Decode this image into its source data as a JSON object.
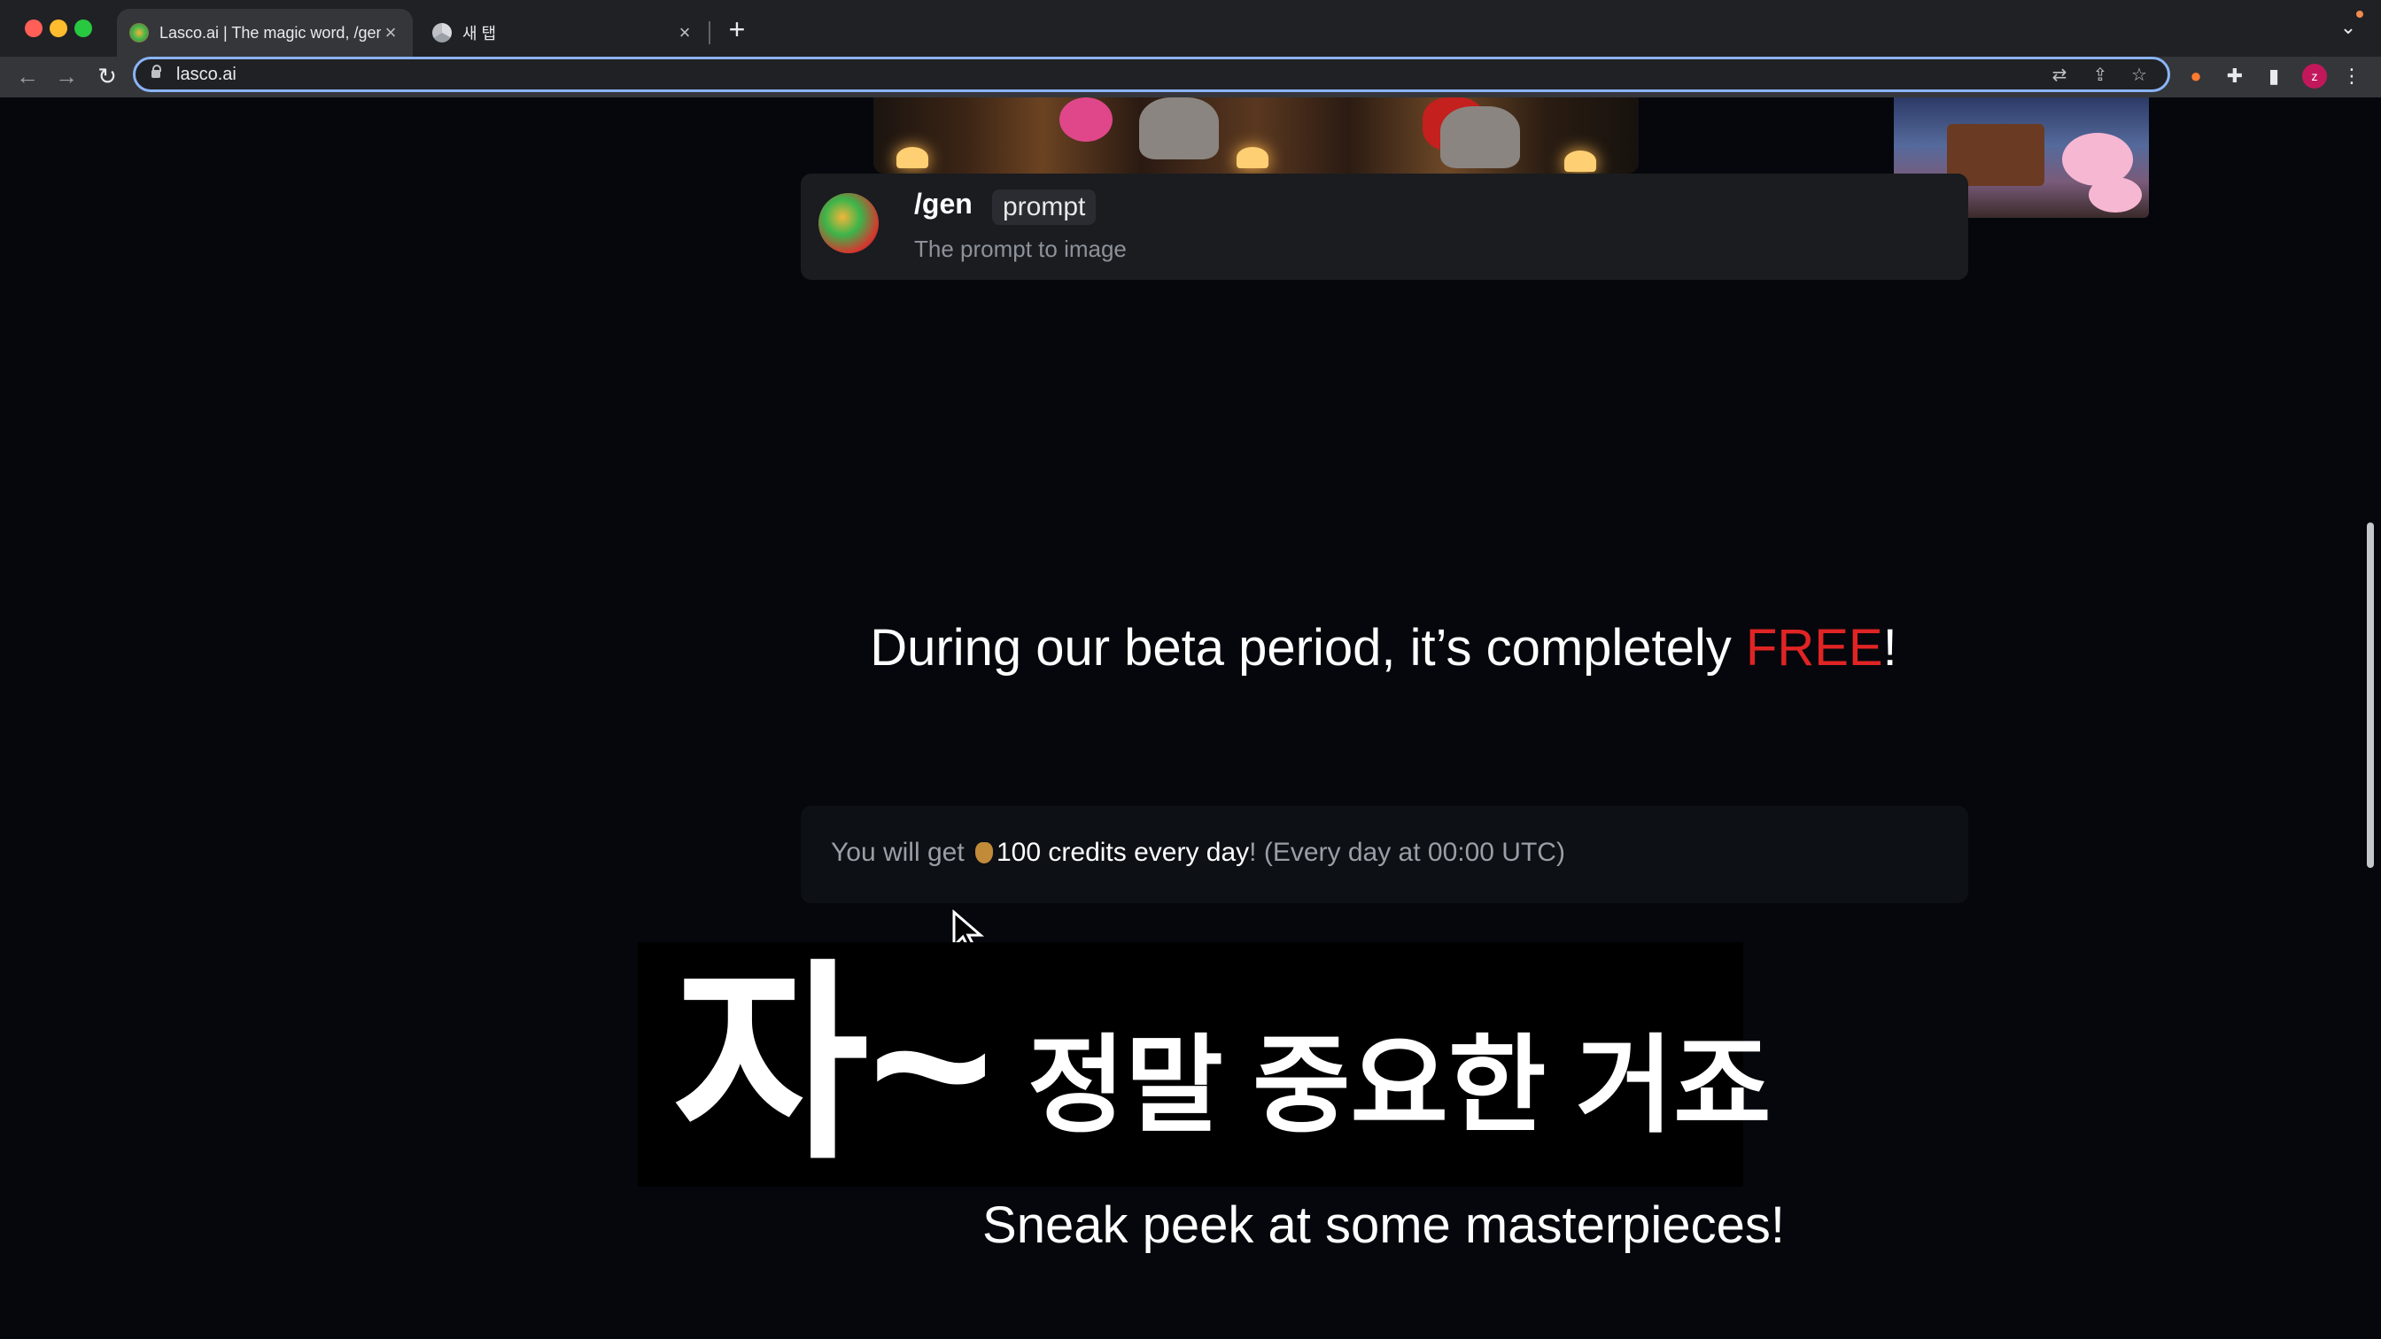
{
  "browser": {
    "tabs": [
      {
        "title": "Lasco.ai | The magic word, /gen",
        "active": true
      },
      {
        "title": "새 탭",
        "active": false
      }
    ],
    "new_tab_label": "+",
    "url": "lasco.ai",
    "profile_initial": "z"
  },
  "page": {
    "command_card": {
      "command": "/gen",
      "parameter": "prompt",
      "description": "The prompt to image"
    },
    "beta_banner": {
      "prefix": "During our beta period, it’s completely ",
      "highlight": "FREE",
      "suffix": "!"
    },
    "credits": {
      "prefix": "You will get ",
      "highlight": "100 credits every day",
      "suffix": "! (Every day at 00:00 UTC)"
    },
    "sneak_peek_title": "Sneak peek at some masterpieces!"
  },
  "caption": {
    "big": "자~",
    "small": "정말 중요한 거죠"
  },
  "colors": {
    "free_highlight": "#e02424",
    "focus_ring": "#8ab4f8"
  }
}
